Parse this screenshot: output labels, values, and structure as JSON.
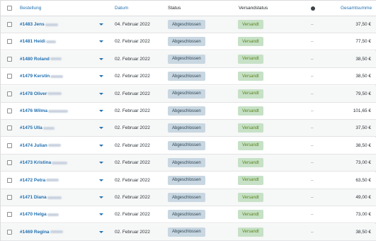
{
  "header": {
    "col_order": "Bestellung",
    "col_date": "Datum",
    "col_status": "Status",
    "col_shipping": "Versandstatus",
    "col_icon": "info-circle-icon",
    "col_total": "Gesamtsumme"
  },
  "rows": [
    {
      "order": "#1483 Jens",
      "date": "04. Februar 2022",
      "status": "Abgeschlossen",
      "shipping": "Versandt",
      "note": "–",
      "total": "37,50 €"
    },
    {
      "order": "#1481 Heidi",
      "date": "02. Februar 2022",
      "status": "Abgeschlossen",
      "shipping": "Versandt",
      "note": "–",
      "total": "77,50 €"
    },
    {
      "order": "#1480 Roland",
      "date": "02. Februar 2022",
      "status": "Abgeschlossen",
      "shipping": "Versandt",
      "note": "–",
      "total": "38,50 €"
    },
    {
      "order": "#1479 Kerstin",
      "date": "02. Februar 2022",
      "status": "Abgeschlossen",
      "shipping": "Versandt",
      "note": "–",
      "total": "38,50 €"
    },
    {
      "order": "#1478 Oliver",
      "date": "02. Februar 2022",
      "status": "Abgeschlossen",
      "shipping": "Versandt",
      "note": "–",
      "total": "79,50 €"
    },
    {
      "order": "#1476 Wilma",
      "date": "02. Februar 2022",
      "status": "Abgeschlossen",
      "shipping": "Versandt",
      "note": "–",
      "total": "101,65 €"
    },
    {
      "order": "#1475 Ulla",
      "date": "02. Februar 2022",
      "status": "Abgeschlossen",
      "shipping": "Versandt",
      "note": "–",
      "total": "37,50 €"
    },
    {
      "order": "#1474 Julian",
      "date": "02. Februar 2022",
      "status": "Abgeschlossen",
      "shipping": "Versandt",
      "note": "–",
      "total": "38,50 €"
    },
    {
      "order": "#1473 Kristina",
      "date": "02. Februar 2022",
      "status": "Abgeschlossen",
      "shipping": "Versandt",
      "note": "–",
      "total": "73,00 €"
    },
    {
      "order": "#1472 Petra",
      "date": "02. Februar 2022",
      "status": "Abgeschlossen",
      "shipping": "Versandt",
      "note": "–",
      "total": "63,50 €"
    },
    {
      "order": "#1471 Diana",
      "date": "02. Februar 2022",
      "status": "Abgeschlossen",
      "shipping": "Versandt",
      "note": "–",
      "total": "49,00 €"
    },
    {
      "order": "#1470 Helga",
      "date": "02. Februar 2022",
      "status": "Abgeschlossen",
      "shipping": "Versandt",
      "note": "–",
      "total": "73,00 €"
    },
    {
      "order": "#1469 Regina",
      "date": "02. Februar 2022",
      "status": "Abgeschlossen",
      "shipping": "Versandt",
      "note": "–",
      "total": "38,50 €"
    }
  ]
}
